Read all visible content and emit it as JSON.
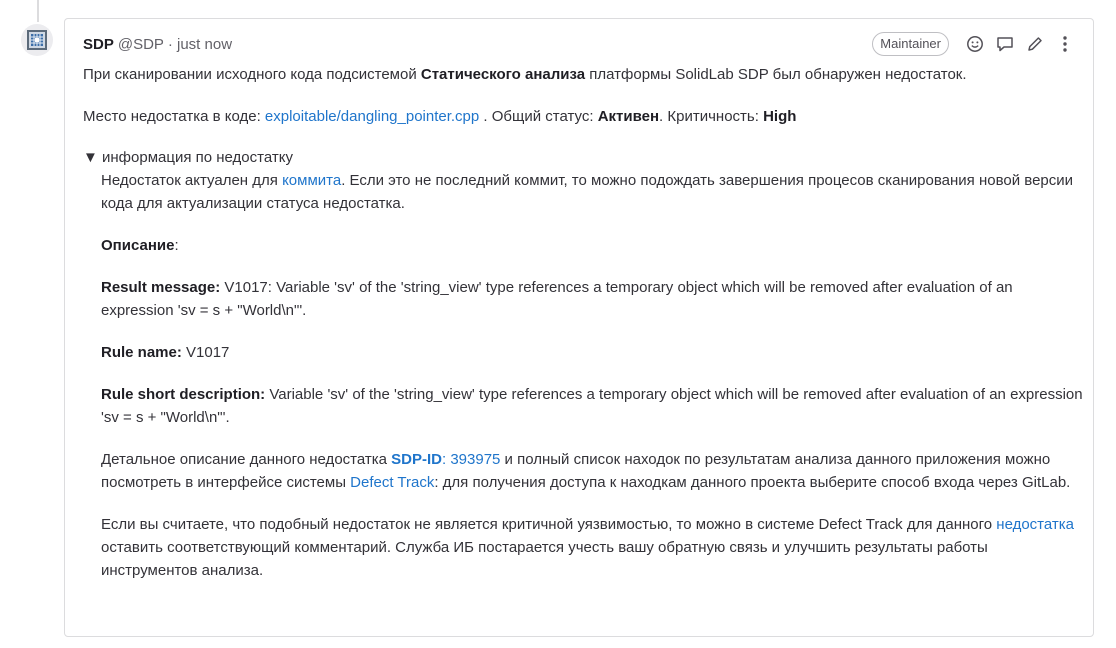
{
  "note": {
    "author_name": "SDP",
    "author_handle": "@SDP",
    "separator": " · ",
    "timestamp": "just now",
    "role_badge": "Maintainer"
  },
  "body": {
    "intro_before": "При сканировании исходного кода подсистемой ",
    "intro_bold": "Статического анализа",
    "intro_after": " платформы SolidLab SDP был обнаружен недостаток.",
    "location_label": "Место недостатка в коде: ",
    "location_link": "exploitable/dangling_pointer.cpp",
    "status_label": " . Общий статус: ",
    "status_value": "Активен",
    "criticality_label": ". Критичность: ",
    "criticality_value": "High",
    "details_summary": "информация по недостатку",
    "actual_before": "Недостаток актуален для ",
    "actual_link": "коммита",
    "actual_after": ". Если это не последний коммит, то можно подождать завершения процесов сканирования новой версии кода для актуализации статуса недостатка.",
    "description_label": "Описание",
    "description_colon": ":",
    "result_label": "Result message:",
    "result_text": " V1017: Variable 'sv' of the 'string_view' type references a temporary object which will be removed after evaluation of an expression 'sv = s + \"World\\n\"'.",
    "rule_name_label": "Rule name:",
    "rule_name_value": " V1017",
    "rule_short_label": "Rule short description:",
    "rule_short_text": " Variable 'sv' of the 'string_view' type references a temporary object which will be removed after evaluation of an expression 'sv = s + \"World\\n\"'.",
    "detail_before": "Детальное описание данного недостатка ",
    "sdp_id_label": "SDP-ID",
    "sdp_id_value": ": 393975",
    "detail_middle": " и полный список находок по результатам анализа данного приложения можно посмотреть в интерфейсе системы ",
    "defect_track_link": "Defect Track",
    "detail_after": ": для получения доступа к находкам данного проекта выберите способ входа через GitLab.",
    "feedback_before": "Если вы считаете, что подобный недостаток не является критичной уязвимостью, то можно в системе Defect Track для данного ",
    "feedback_link": "недостатка",
    "feedback_after": " оставить соответствующий комментарий. Служба ИБ постарается учесть вашу обратную связь и улучшить результаты работы инструментов анализа."
  },
  "icons": {
    "avatar": "avatar-icon",
    "emoji": "smiley-icon",
    "reply": "comment-icon",
    "edit": "pencil-icon",
    "more": "kebab-icon",
    "disclosure": "triangle-down-icon"
  },
  "colors": {
    "link": "#1f75cb",
    "text": "#333238",
    "border": "#dcdcde"
  }
}
